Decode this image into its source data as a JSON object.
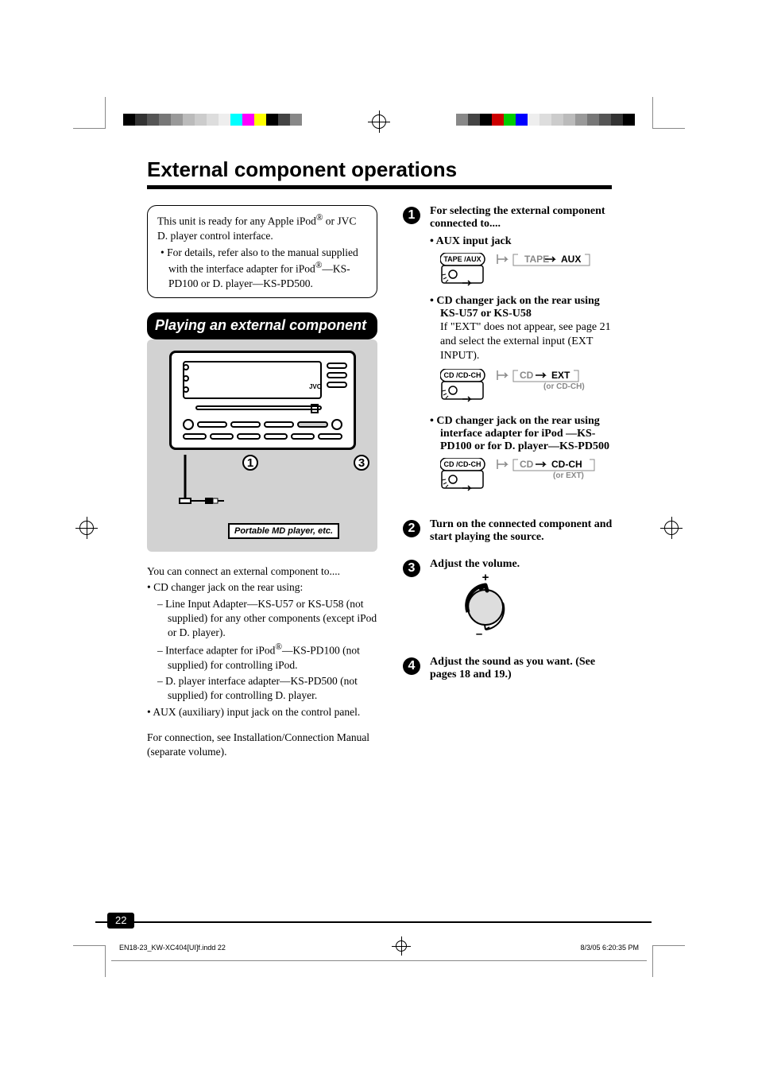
{
  "page_number": "22",
  "title": "External component operations",
  "callout": {
    "line1_a": "This unit is ready for any Apple iPod",
    "line1_sup": "®",
    "line1_b": " or JVC D. player control interface.",
    "bullet_a": "•  For details, refer also to the manual supplied with the interface adapter for iPod",
    "bullet_sup": "®",
    "bullet_b": "—KS-PD100 or D. player—KS-PD500."
  },
  "subhead": "Playing an external component",
  "figure": {
    "jvc": "JVC",
    "callout_1": "1",
    "callout_3": "3",
    "md_label": "Portable MD player, etc."
  },
  "left_body": {
    "intro": "You can connect an external component to....",
    "li1a": "•  CD changer jack on the rear using:",
    "li2a": "–  Line Input Adapter—KS-U57 or KS-U58 (not supplied) for any other components (except iPod or D. player).",
    "li2b_a": "–  Interface adapter for iPod",
    "li2b_sup": "®",
    "li2b_b": "—KS-PD100 (not supplied) for controlling iPod.",
    "li2c": "–  D. player interface adapter—KS-PD500 (not supplied) for controlling D. player.",
    "li1b": "•  AUX (auxiliary) input jack on the control panel.",
    "footer": "For connection, see Installation/Connection Manual (separate volume)."
  },
  "steps": {
    "s1_title": "For selecting the external component connected to....",
    "s1_b1": "•  AUX input jack",
    "s1_flow1": {
      "btn": "TAPE /AUX",
      "a": "TAPE",
      "b": "AUX"
    },
    "s1_b2": "•  CD changer jack on the rear using KS-U57 or KS-U58",
    "s1_b2_sub": "If \"EXT\" does not appear, see page 21 and select the external input (EXT INPUT).",
    "s1_flow2": {
      "btn": "CD /CD-CH",
      "a": "CD",
      "b": "EXT",
      "c": "(or CD-CH)"
    },
    "s1_b3": "•  CD changer jack on the rear using interface adapter for iPod —KS-PD100 or for D. player—KS-PD500",
    "s1_flow3": {
      "btn": "CD /CD-CH",
      "a": "CD",
      "b": "CD-CH",
      "c": "(or EXT)"
    },
    "s2": "Turn on the connected component and start playing the source.",
    "s3": "Adjust the volume.",
    "s4": "Adjust the sound as you want. (See pages 18 and 19.)"
  },
  "footer": {
    "file": "EN18-23_KW-XC404[UI]f.indd   22",
    "date": "8/3/05   6:20:35 PM"
  }
}
